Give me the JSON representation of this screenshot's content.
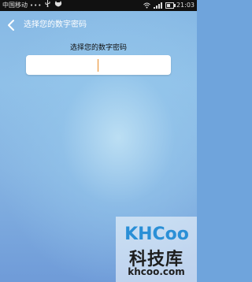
{
  "status_bar": {
    "carrier": "中国移动",
    "dots": "•••",
    "time": "21:03",
    "battery_level": 0.6,
    "signal_bars": 4
  },
  "header": {
    "back_icon": "chevron-left-icon",
    "title": "选择您的数字密码"
  },
  "main": {
    "prompt": "选择您的数字密码",
    "pin_value": "",
    "cursor_color": "#e98a24"
  },
  "watermark": {
    "logo_text": "KHCoo",
    "cn_text": "科技库",
    "url_text": "khcoo.com"
  }
}
